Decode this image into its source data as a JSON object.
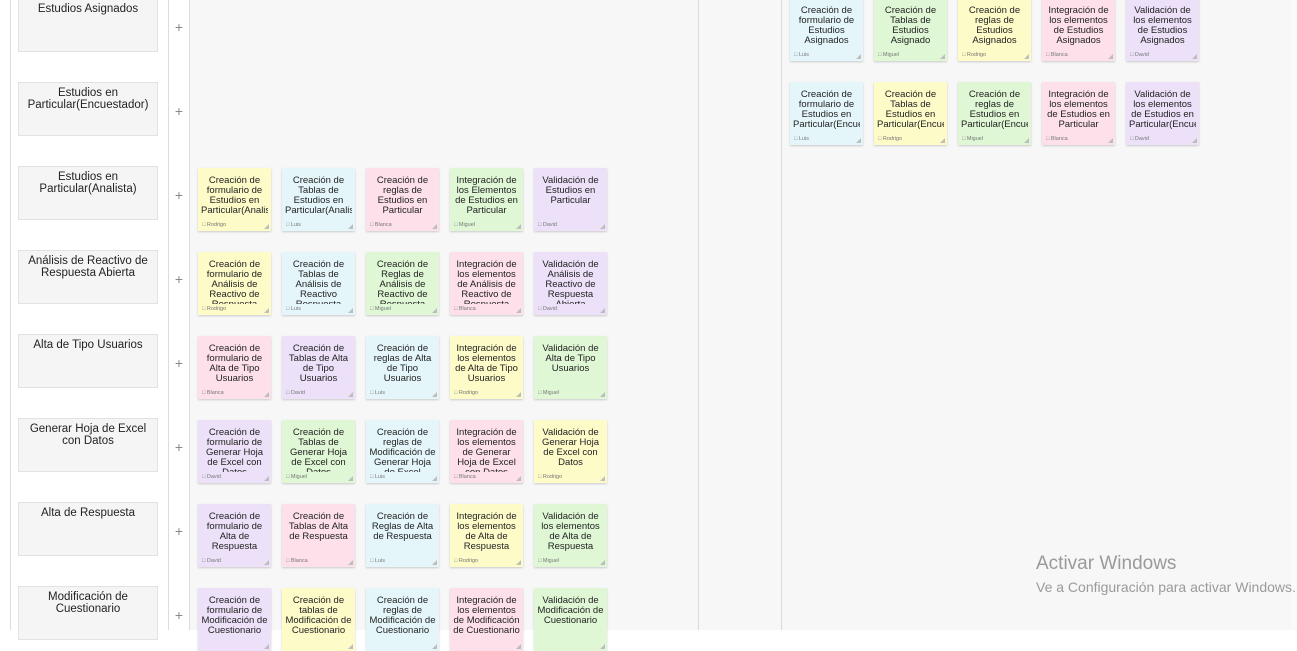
{
  "board": {
    "rows": [
      {
        "label": "Estudios Asignados",
        "notes": []
      },
      {
        "label": "Estudios en Particular(Encuestador)",
        "notes": []
      },
      {
        "label": "Estudios en Particular(Analista)",
        "notes": [
          {
            "text": "Creación de formulario de Estudios en Particular(Analista)",
            "assignee": "Rodrigo",
            "color": "#fdfbc7"
          },
          {
            "text": "Creación de Tablas de Estudios en Particular(Analista)",
            "assignee": "Luis",
            "color": "#e5f6fb"
          },
          {
            "text": "Creación de reglas de Estudios en Particular",
            "assignee": "Blanca",
            "color": "#fde0ea"
          },
          {
            "text": "Integración de los Elementos de Estudios en Particular",
            "assignee": "Miguel",
            "color": "#dff7d4"
          },
          {
            "text": "Validación de Estudios en Particular",
            "assignee": "David",
            "color": "#ece1f8"
          }
        ]
      },
      {
        "label": "Análisis de Reactivo de Respuesta Abierta",
        "notes": [
          {
            "text": "Creación de formulario de Análisis de Reactivo de Respuesta Abierta",
            "assignee": "Rodrigo",
            "color": "#fdfbc7"
          },
          {
            "text": "Creación de Tablas de Análisis de Reactivo Respuesta Abierta",
            "assignee": "Luis",
            "color": "#e5f6fb"
          },
          {
            "text": "Creación de Reglas de Análisis de Reactivo de Respuesta Abierta",
            "assignee": "Miguel",
            "color": "#dff7d4"
          },
          {
            "text": "Integración de los elementos de Análisis de Reactivo de Respuesta Abierta",
            "assignee": "Blanca",
            "color": "#fde0ea"
          },
          {
            "text": "Validación de Análisis de Reactivo de Respuesta Abierta",
            "assignee": "David",
            "color": "#ece1f8"
          }
        ]
      },
      {
        "label": "Alta de Tipo Usuarios",
        "notes": [
          {
            "text": "Creación de formulario de Alta de Tipo Usuarios",
            "assignee": "Blanca",
            "color": "#fde0ea"
          },
          {
            "text": "Creación de Tablas de Alta de Tipo Usuarios",
            "assignee": "David",
            "color": "#ece1f8"
          },
          {
            "text": "Creación de reglas de Alta de Tipo Usuarios",
            "assignee": "Luis",
            "color": "#e5f6fb"
          },
          {
            "text": "Integración de los elementos de Alta de Tipo Usuarios",
            "assignee": "Rodrigo",
            "color": "#fdfbc7"
          },
          {
            "text": "Validación de Alta de Tipo Usuarios",
            "assignee": "Miguel",
            "color": "#dff7d4"
          }
        ]
      },
      {
        "label": "Generar Hoja de Excel con Datos",
        "notes": [
          {
            "text": "Creación de formulario de Generar Hoja de Excel con Datos",
            "assignee": "David",
            "color": "#ece1f8"
          },
          {
            "text": "Creación de Tablas de Generar Hoja de Excel con Datos",
            "assignee": "Miguel",
            "color": "#dff7d4"
          },
          {
            "text": "Creación de reglas de Modificación de Generar Hoja de Excel",
            "assignee": "Luis",
            "color": "#e5f6fb"
          },
          {
            "text": "Integración de los elementos de Generar Hoja de Excel con Datos",
            "assignee": "Blanca",
            "color": "#fde0ea"
          },
          {
            "text": "Validación de Generar Hoja de Excel con Datos",
            "assignee": "Rodrigo",
            "color": "#fdfbc7"
          }
        ]
      },
      {
        "label": "Alta de Respuesta",
        "notes": [
          {
            "text": "Creación de formulario de Alta de Respuesta",
            "assignee": "David",
            "color": "#ece1f8"
          },
          {
            "text": "Creación de Tablas de Alta de Respuesta",
            "assignee": "Blanca",
            "color": "#fde0ea"
          },
          {
            "text": "Creación de Reglas de Alta de Respuesta",
            "assignee": "Luis",
            "color": "#e5f6fb"
          },
          {
            "text": "Integración de los elementos de Alta de Respuesta",
            "assignee": "Rodrigo",
            "color": "#fdfbc7"
          },
          {
            "text": "Validación de los elementos de Alta de Respuesta",
            "assignee": "Miguel",
            "color": "#dff7d4"
          }
        ]
      },
      {
        "label": "Modificación de Cuestionario",
        "notes": [
          {
            "text": "Creación de formulario de Modificación de Cuestionario",
            "assignee": "",
            "color": "#ece1f8"
          },
          {
            "text": "Creación de tablas de Modificación de Cuestionario",
            "assignee": "",
            "color": "#fdfbc7"
          },
          {
            "text": "Creación de reglas de Modificación de Cuestionario",
            "assignee": "",
            "color": "#e5f6fb"
          },
          {
            "text": "Integración de los elementos de Modificación de Cuestionario",
            "assignee": "",
            "color": "#fde0ea"
          },
          {
            "text": "Validación de Modificación de Cuestionario",
            "assignee": "",
            "color": "#dff7d4"
          }
        ]
      }
    ],
    "done_notes": [
      [
        {
          "text": "Creación de formulario de Estudios Asignados",
          "assignee": "Luis",
          "color": "#e5f6fb"
        },
        {
          "text": "Creación de Tablas de Estudios Asignado",
          "assignee": "Miguel",
          "color": "#dff7d4"
        },
        {
          "text": "Creación de reglas de Estudios Asignados",
          "assignee": "Rodrigo",
          "color": "#fdfbc7"
        },
        {
          "text": "Integración de los elementos de Estudios Asignados",
          "assignee": "Blanca",
          "color": "#fde0ea"
        },
        {
          "text": "Validación de los elementos de Estudios Asignados",
          "assignee": "David",
          "color": "#ece1f8"
        }
      ],
      [
        {
          "text": "Creación de formulario de Estudios en Particular(Encuestador)",
          "assignee": "Luis",
          "color": "#e5f6fb"
        },
        {
          "text": "Creación de Tablas de Estudios en Particular(Encuestador)",
          "assignee": "Rodrigo",
          "color": "#fdfbc7"
        },
        {
          "text": "Creación de reglas de Estudios en Particular(Encuestador)",
          "assignee": "Miguel",
          "color": "#dff7d4"
        },
        {
          "text": "Integración de los elementos de Estudios en Particular",
          "assignee": "Blanca",
          "color": "#fde0ea"
        },
        {
          "text": "Validación de los elementos de Estudios en Particular(Encuestador)",
          "assignee": "David",
          "color": "#ece1f8"
        }
      ]
    ],
    "plus_label": "+"
  },
  "watermark": {
    "title": "Activar Windows",
    "subtitle": "Ve a Configuración para activar Windows."
  }
}
